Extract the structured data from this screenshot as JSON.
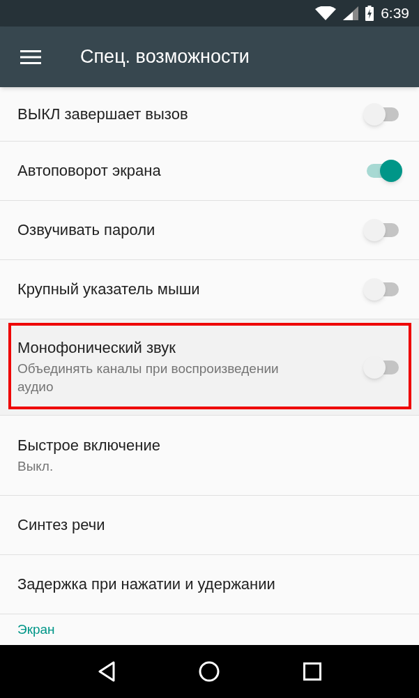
{
  "status_bar": {
    "time": "6:39"
  },
  "toolbar": {
    "title": "Спец. возможности"
  },
  "settings": [
    {
      "kind": "switch",
      "title": "ВЫКЛ завершает вызов",
      "on": false,
      "highlighted": false
    },
    {
      "kind": "switch",
      "title": "Автоповорот экрана",
      "on": true,
      "highlighted": false
    },
    {
      "kind": "switch",
      "title": "Озвучивать пароли",
      "on": false,
      "highlighted": false
    },
    {
      "kind": "switch",
      "title": "Крупный указатель мыши",
      "on": false,
      "highlighted": false
    },
    {
      "kind": "switch",
      "title": "Монофонический звук",
      "summary": "Объединять каналы при воспроизведении аудио",
      "on": false,
      "highlighted": true
    },
    {
      "kind": "link",
      "title": "Быстрое включение",
      "summary": "Выкл."
    },
    {
      "kind": "link",
      "title": "Синтез речи"
    },
    {
      "kind": "link",
      "title": "Задержка при нажатии и удержании"
    },
    {
      "kind": "header",
      "title": "Экран"
    }
  ]
}
